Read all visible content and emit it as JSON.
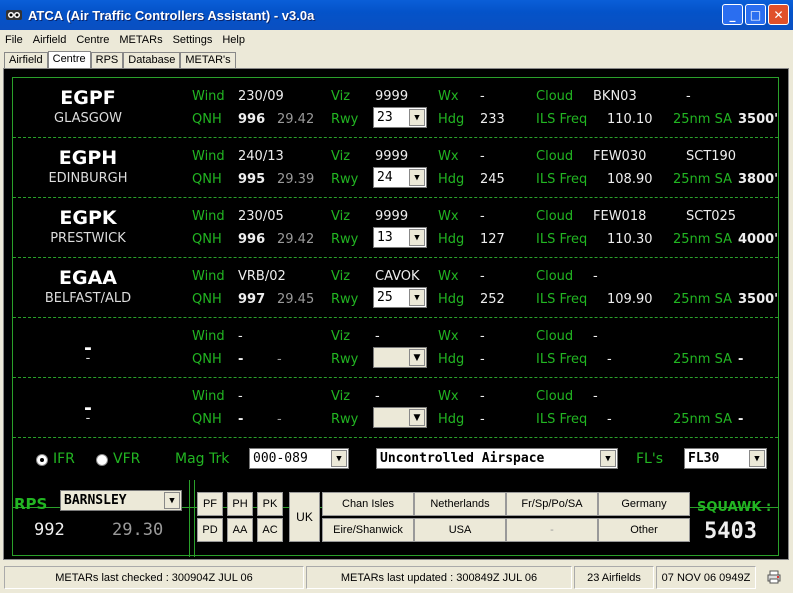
{
  "window": {
    "title": "ATCA (Air Traffic Controllers Assistant) - v3.0a",
    "minimize": "_",
    "maximize": "□",
    "close": "✕"
  },
  "menu": [
    "File",
    "Airfield",
    "Centre",
    "METARs",
    "Settings",
    "Help"
  ],
  "tabs": [
    "Airfield",
    "Centre",
    "RPS",
    "Database",
    "METAR's"
  ],
  "labels": {
    "wind": "Wind",
    "qnh": "QNH",
    "viz": "Viz",
    "rwy": "Rwy",
    "wx": "Wx",
    "hdg": "Hdg",
    "cloud": "Cloud",
    "ils": "ILS Freq",
    "sa": "25nm SA"
  },
  "airfields": [
    {
      "icao": "EGPF",
      "name": "GLASGOW",
      "wind": "230/09",
      "qnh": "996",
      "qnh_in": "29.42",
      "viz": "9999",
      "rwy": "23",
      "wx": "-",
      "hdg": "233",
      "cloud1": "BKN03",
      "cloud2": "-",
      "ils": "110.10",
      "sa": "3500'"
    },
    {
      "icao": "EGPH",
      "name": "EDINBURGH",
      "wind": "240/13",
      "qnh": "995",
      "qnh_in": "29.39",
      "viz": "9999",
      "rwy": "24",
      "wx": "-",
      "hdg": "245",
      "cloud1": "FEW030",
      "cloud2": "SCT190",
      "ils": "108.90",
      "sa": "3800'"
    },
    {
      "icao": "EGPK",
      "name": "PRESTWICK",
      "wind": "230/05",
      "qnh": "996",
      "qnh_in": "29.42",
      "viz": "9999",
      "rwy": "13",
      "wx": "-",
      "hdg": "127",
      "cloud1": "FEW018",
      "cloud2": "SCT025",
      "ils": "110.30",
      "sa": "4000'"
    },
    {
      "icao": "EGAA",
      "name": "BELFAST/ALD",
      "wind": "VRB/02",
      "qnh": "997",
      "qnh_in": "29.45",
      "viz": "CAVOK",
      "rwy": "25",
      "wx": "-",
      "hdg": "252",
      "cloud1": "-",
      "cloud2": "",
      "ils": "109.90",
      "sa": "3500'"
    },
    {
      "icao": "-",
      "name": "-",
      "wind": "-",
      "qnh": "-",
      "qnh_in": "-",
      "viz": "-",
      "rwy": "",
      "wx": "-",
      "hdg": "-",
      "cloud1": "-",
      "cloud2": "",
      "ils": "-",
      "sa": "-"
    },
    {
      "icao": "-",
      "name": "-",
      "wind": "-",
      "qnh": "-",
      "qnh_in": "-",
      "viz": "-",
      "rwy": "",
      "wx": "-",
      "hdg": "-",
      "cloud1": "-",
      "cloud2": "",
      "ils": "-",
      "sa": "-"
    }
  ],
  "controls": {
    "ifr": "IFR",
    "vfr": "VFR",
    "mag_trk_label": "Mag Trk",
    "mag_trk": "000-089",
    "airspace": "Uncontrolled Airspace",
    "fls_label": "FL's",
    "fl": "FL30"
  },
  "rps": {
    "label": "RPS",
    "region": "BARNSLEY",
    "value": "992",
    "value_in": "29.30"
  },
  "regions": {
    "codes": [
      "PF",
      "PH",
      "PK",
      "PD",
      "AA",
      "AC"
    ],
    "uk": "UK",
    "buttons": [
      "Chan Isles",
      "Netherlands",
      "Fr/Sp/Po/SA",
      "Germany",
      "Eire/Shanwick",
      "USA",
      "-",
      "Other"
    ]
  },
  "squawk": {
    "label": "SQUAWK :",
    "value": "5403"
  },
  "status": {
    "checked": "METARs last checked : 300904Z JUL 06",
    "updated": "METARs last updated : 300849Z JUL 06",
    "airfields": "23 Airfields",
    "datetime": "07 NOV 06 0949Z"
  }
}
